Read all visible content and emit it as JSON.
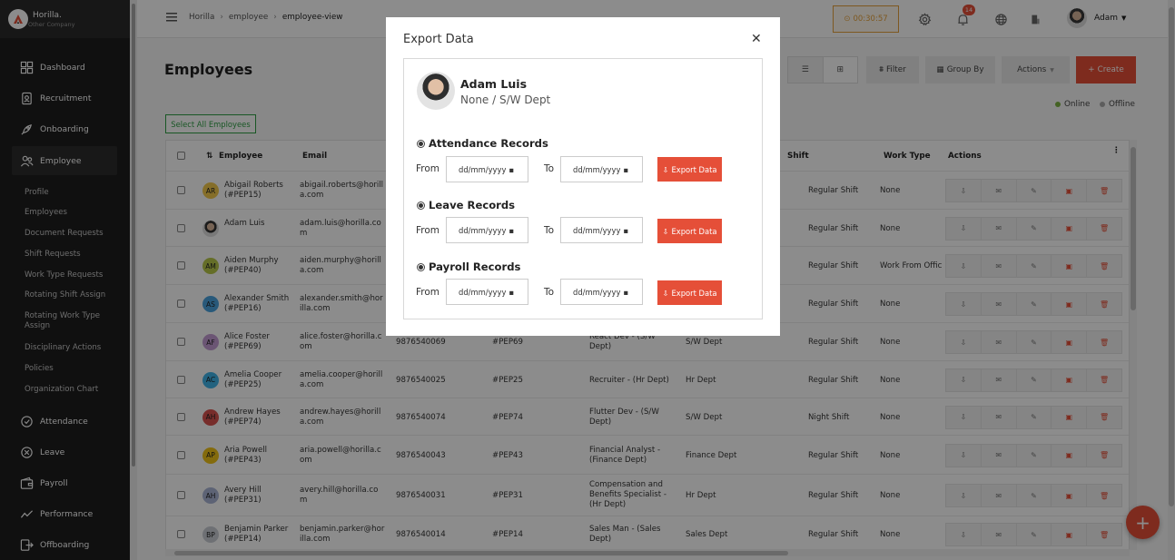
{
  "brand": {
    "name": "Horilla.",
    "sub": "Other Company"
  },
  "sidebar": {
    "items": [
      {
        "label": "Dashboard",
        "icon": "dashboard-icon"
      },
      {
        "label": "Recruitment",
        "icon": "recruitment-icon"
      },
      {
        "label": "Onboarding",
        "icon": "rocket-icon"
      },
      {
        "label": "Employee",
        "icon": "people-icon"
      },
      {
        "label": "Attendance",
        "icon": "attendance-icon"
      },
      {
        "label": "Leave",
        "icon": "leave-icon"
      },
      {
        "label": "Payroll",
        "icon": "wallet-icon"
      },
      {
        "label": "Performance",
        "icon": "chart-icon"
      },
      {
        "label": "Offboarding",
        "icon": "exit-icon"
      }
    ],
    "employee_sub": [
      "Profile",
      "Employees",
      "Document Requests",
      "Shift Requests",
      "Work Type Requests",
      "Rotating Shift Assign",
      "Rotating Work Type Assign",
      "Disciplinary Actions",
      "Policies",
      "Organization Chart"
    ]
  },
  "breadcrumb": [
    "Horilla",
    "employee",
    "employee-view"
  ],
  "header": {
    "timer": "00:30:57",
    "notifications": "14",
    "user": "Adam"
  },
  "page": {
    "title": "Employees",
    "filter": "Filter",
    "group_by": "Group By",
    "actions": "Actions",
    "create": "Create",
    "online": "Online",
    "offline": "Offline",
    "select_all": "Select All Employees"
  },
  "table": {
    "headers": {
      "employee": "Employee",
      "email": "Email",
      "shift": "Shift",
      "work_type": "Work Type",
      "actions": "Actions"
    },
    "rows": [
      {
        "initials": "AR",
        "color": "#f2c94c",
        "name": "Abigail Roberts",
        "id": "(#PEP15)",
        "email1": "abigail.roberts@horill",
        "email2": "a.com",
        "phone": "",
        "badge": "",
        "job1": "",
        "job2": "",
        "dept": "",
        "shift": "Regular Shift",
        "work": "None"
      },
      {
        "initials": "",
        "color": "photo",
        "name": "Adam Luis",
        "id": "",
        "email1": "adam.luis@horilla.co",
        "email2": "m",
        "phone": "",
        "badge": "",
        "job1": "",
        "job2": "",
        "dept": "",
        "shift": "Regular Shift",
        "work": "None"
      },
      {
        "initials": "AM",
        "color": "#b8c94a",
        "name": "Aiden Murphy",
        "id": "(#PEP40)",
        "email1": "aiden.murphy@horill",
        "email2": "a.com",
        "phone": "",
        "badge": "",
        "job1": "",
        "job2": "",
        "dept": "",
        "shift": "Regular Shift",
        "work": "Work From Offic"
      },
      {
        "initials": "AS",
        "color": "#4aa3df",
        "name": "Alexander Smith",
        "id": "(#PEP16)",
        "email1": "alexander.smith@hor",
        "email2": "illa.com",
        "phone": "",
        "badge": "",
        "job1": "",
        "job2": "",
        "dept": "",
        "shift": "Regular Shift",
        "work": "None"
      },
      {
        "initials": "AF",
        "color": "#c39bd3",
        "name": "Alice Foster",
        "id": "(#PEP69)",
        "email1": "alice.foster@horilla.c",
        "email2": "om",
        "phone": "9876540069",
        "badge": "#PEP69",
        "job1": "React Dev - (S/W",
        "job2": "Dept)",
        "dept": "S/W Dept",
        "shift": "Regular Shift",
        "work": "None"
      },
      {
        "initials": "AC",
        "color": "#3fb3e8",
        "name": "Amelia Cooper",
        "id": "(#PEP25)",
        "email1": "amelia.cooper@horill",
        "email2": "a.com",
        "phone": "9876540025",
        "badge": "#PEP25",
        "job1": "Recruiter - (Hr Dept)",
        "job2": "",
        "dept": "Hr Dept",
        "shift": "Regular Shift",
        "work": "None"
      },
      {
        "initials": "AH",
        "color": "#d9534f",
        "name": "Andrew Hayes",
        "id": "(#PEP74)",
        "email1": "andrew.hayes@horill",
        "email2": "a.com",
        "phone": "9876540074",
        "badge": "#PEP74",
        "job1": "Flutter Dev - (S/W",
        "job2": "Dept)",
        "dept": "S/W Dept",
        "shift": "Night Shift",
        "work": "None"
      },
      {
        "initials": "AP",
        "color": "#f0c419",
        "name": "Aria Powell",
        "id": "(#PEP43)",
        "email1": "aria.powell@horilla.c",
        "email2": "om",
        "phone": "9876540043",
        "badge": "#PEP43",
        "job1": "Financial Analyst -",
        "job2": "(Finance Dept)",
        "dept": "Finance Dept",
        "shift": "Regular Shift",
        "work": "None"
      },
      {
        "initials": "AH",
        "color": "#aab4d6",
        "name": "Avery Hill",
        "id": "(#PEP31)",
        "email1": "avery.hill@horilla.co",
        "email2": "m",
        "phone": "9876540031",
        "badge": "#PEP31",
        "job1": "Compensation and",
        "job2": "Benefits Specialist -",
        "job3": "(Hr Dept)",
        "dept": "Hr Dept",
        "shift": "Regular Shift",
        "work": "None"
      },
      {
        "initials": "BP",
        "color": "#c9cdd4",
        "name": "Benjamin Parker",
        "id": "(#PEP14)",
        "email1": "benjamin.parker@hor",
        "email2": "illa.com",
        "phone": "9876540014",
        "badge": "#PEP14",
        "job1": "Sales Man - (Sales",
        "job2": "Dept)",
        "dept": "Sales Dept",
        "shift": "Regular Shift",
        "work": "None"
      }
    ]
  },
  "modal": {
    "title": "Export Data",
    "name": "Adam Luis",
    "dept": "None / S/W Dept",
    "sections": [
      {
        "title": "Attendance Records"
      },
      {
        "title": "Leave Records"
      },
      {
        "title": "Payroll Records"
      }
    ],
    "from_label": "From",
    "to_label": "To",
    "date_placeholder": "dd/mm/yyyy",
    "export_label": "Export Data"
  },
  "colors": {
    "accent": "#e54f38",
    "sidebar": "#1e1e1e",
    "online": "#7cb342",
    "offline": "#aaaaaa",
    "timer": "#e6a13b"
  }
}
